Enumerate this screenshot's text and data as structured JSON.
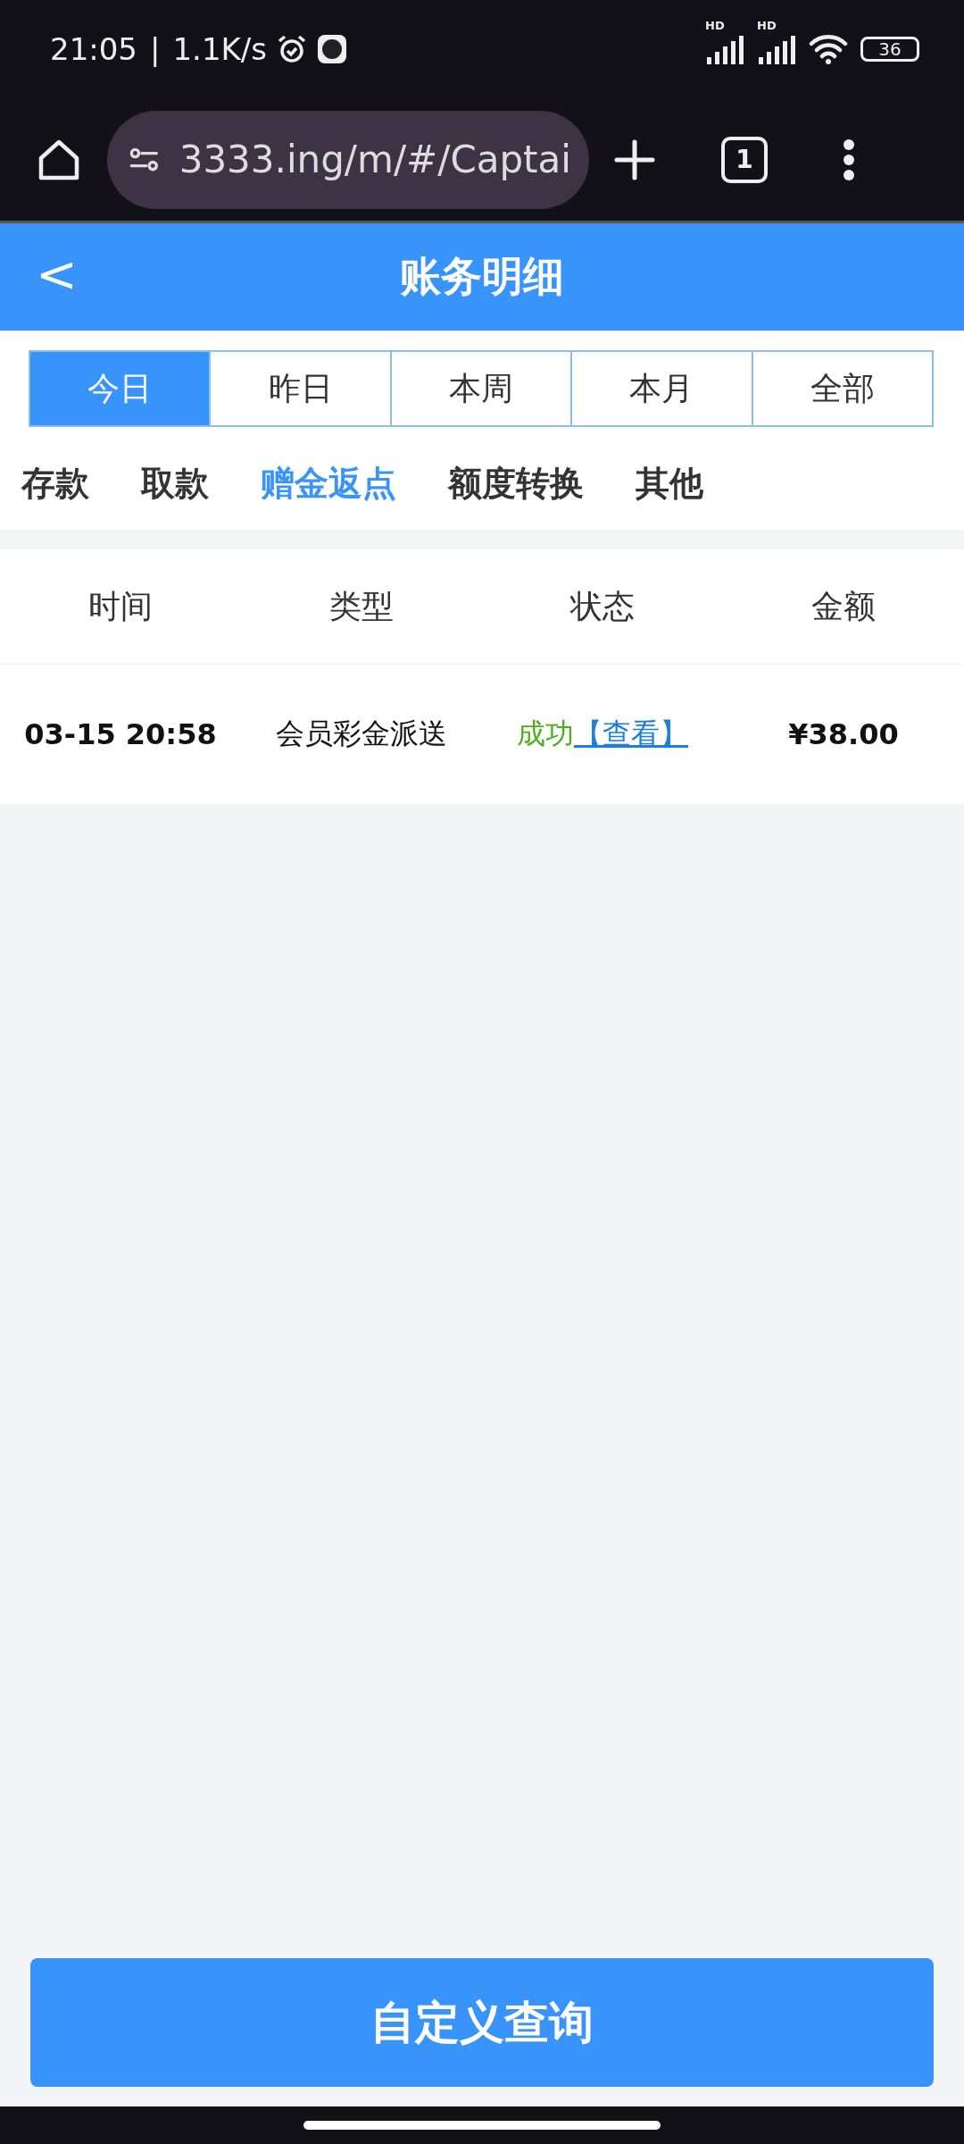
{
  "status_bar": {
    "time": "21:05",
    "separator": "|",
    "speed": "1.1K/s",
    "signal_labels": [
      "HD",
      "HD"
    ],
    "battery": "36"
  },
  "browser": {
    "url": "3333.ing/m/#/Captai",
    "tab_count": "1"
  },
  "header": {
    "back": "<",
    "title": "账务明细"
  },
  "periods": [
    {
      "label": "今日",
      "selected": true
    },
    {
      "label": "昨日",
      "selected": false
    },
    {
      "label": "本周",
      "selected": false
    },
    {
      "label": "本月",
      "selected": false
    },
    {
      "label": "全部",
      "selected": false
    }
  ],
  "categories": [
    {
      "label": "存款",
      "selected": false
    },
    {
      "label": "取款",
      "selected": false
    },
    {
      "label": "赠金返点",
      "selected": true
    },
    {
      "label": "额度转换",
      "selected": false
    },
    {
      "label": "其他",
      "selected": false
    }
  ],
  "table": {
    "columns": [
      "时间",
      "类型",
      "状态",
      "金额"
    ],
    "rows": [
      {
        "time": "03-15 20:58",
        "type": "会员彩金派送",
        "status": "成功",
        "link": "【查看】",
        "amount": "¥38.00"
      }
    ]
  },
  "query_button": "自定义查询"
}
